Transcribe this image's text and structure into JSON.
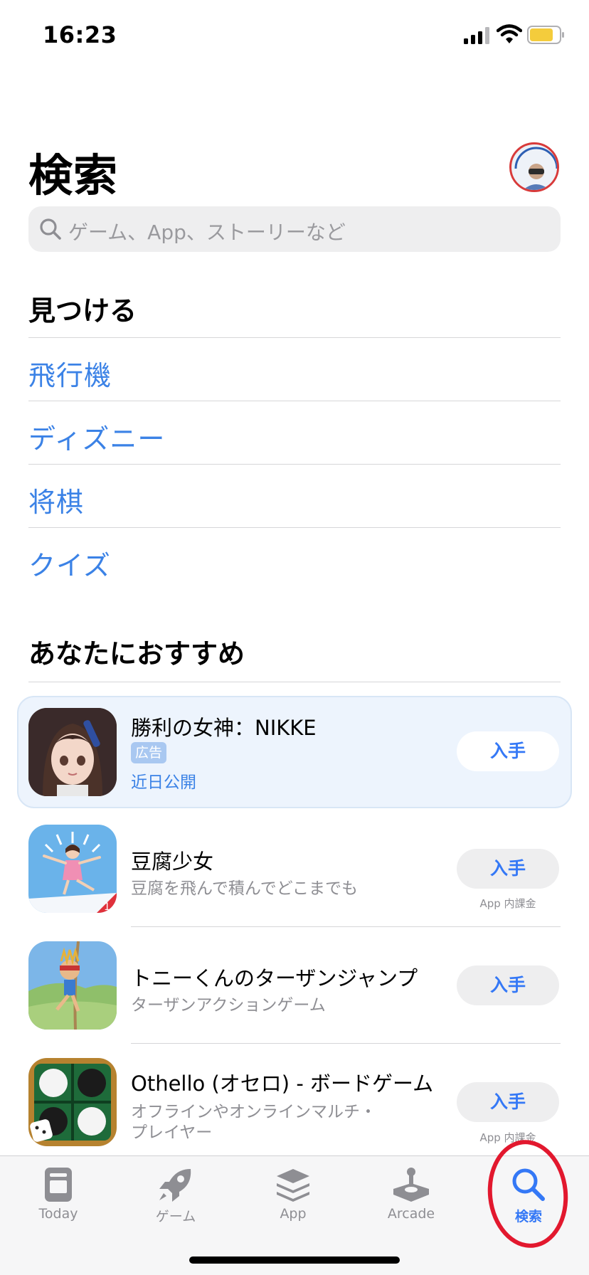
{
  "status_bar": {
    "time": "16:23"
  },
  "header": {
    "title": "検索",
    "search_placeholder": "ゲーム、App、ストーリーなど"
  },
  "discover": {
    "heading": "見つける",
    "items": [
      "飛行機",
      "ディズニー",
      "将棋",
      "クイズ"
    ]
  },
  "recommended": {
    "heading": "あなたにおすすめ",
    "ad": {
      "name": "勝利の女神：NIKKE",
      "badge": "広告",
      "status": "近日公開",
      "button": "入手"
    },
    "apps": [
      {
        "name": "豆腐少女",
        "subtitle": "豆腐を飛んで積んでどこまでも",
        "button": "入手",
        "note": "App 内課金"
      },
      {
        "name": "トニーくんのターザンジャンプ",
        "subtitle": "ターザンアクションゲーム",
        "button": "入手"
      },
      {
        "name": "Othello (オセロ) - ボードゲーム",
        "subtitle_line1": "オフラインやオンラインマルチ・",
        "subtitle_line2": "プレイヤー",
        "button": "入手",
        "note": "App 内課金"
      }
    ]
  },
  "tab_bar": {
    "tabs": [
      {
        "label": "Today",
        "icon": "today-icon"
      },
      {
        "label": "ゲーム",
        "icon": "rocket-icon"
      },
      {
        "label": "App",
        "icon": "layers-icon"
      },
      {
        "label": "Arcade",
        "icon": "joystick-icon"
      },
      {
        "label": "検索",
        "icon": "search-icon",
        "active": true
      }
    ]
  },
  "colors": {
    "accent": "#3478f6",
    "link": "#3b82e6",
    "annotation_circle": "#e2182e"
  }
}
